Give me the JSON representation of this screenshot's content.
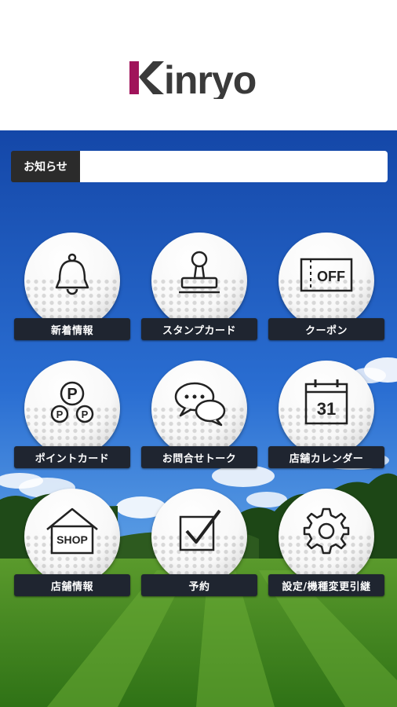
{
  "brand": {
    "logo_text": "Kinryo",
    "accent": "#a0145a",
    "logo_color": "#333333"
  },
  "notice": {
    "label": "お知らせ",
    "value": ""
  },
  "menu": [
    {
      "label": "新着情報",
      "icon": "bell-icon"
    },
    {
      "label": "スタンプカード",
      "icon": "stamp-icon"
    },
    {
      "label": "クーポン",
      "icon": "coupon-icon",
      "icon_text": "OFF"
    },
    {
      "label": "ポイントカード",
      "icon": "points-icon",
      "icon_text": "P"
    },
    {
      "label": "お問合せトーク",
      "icon": "chat-icon"
    },
    {
      "label": "店舗カレンダー",
      "icon": "calendar-icon",
      "icon_text": "31"
    },
    {
      "label": "店舗情報",
      "icon": "shop-icon",
      "icon_text": "SHOP"
    },
    {
      "label": "予約",
      "icon": "checkbox-icon"
    },
    {
      "label": "設定/機種変更引継",
      "icon": "gear-icon"
    }
  ]
}
